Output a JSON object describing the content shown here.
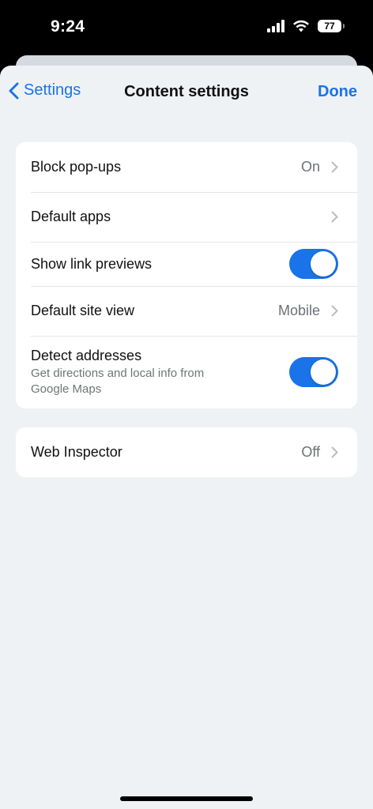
{
  "status_bar": {
    "time": "9:24",
    "battery": "77"
  },
  "nav": {
    "back_label": "Settings",
    "title": "Content settings",
    "done_label": "Done"
  },
  "group1": [
    {
      "label": "Block pop-ups",
      "value": "On"
    },
    {
      "label": "Default apps",
      "value": ""
    },
    {
      "label": "Show link previews",
      "toggle": true
    },
    {
      "label": "Default site view",
      "value": "Mobile"
    },
    {
      "label": "Detect addresses",
      "sublabel": "Get directions and local info from Google Maps",
      "toggle": true
    }
  ],
  "group2": [
    {
      "label": "Web Inspector",
      "value": "Off"
    }
  ],
  "colors": {
    "accent": "#1a73e8",
    "background": "#eff2f5",
    "card": "#ffffff"
  }
}
